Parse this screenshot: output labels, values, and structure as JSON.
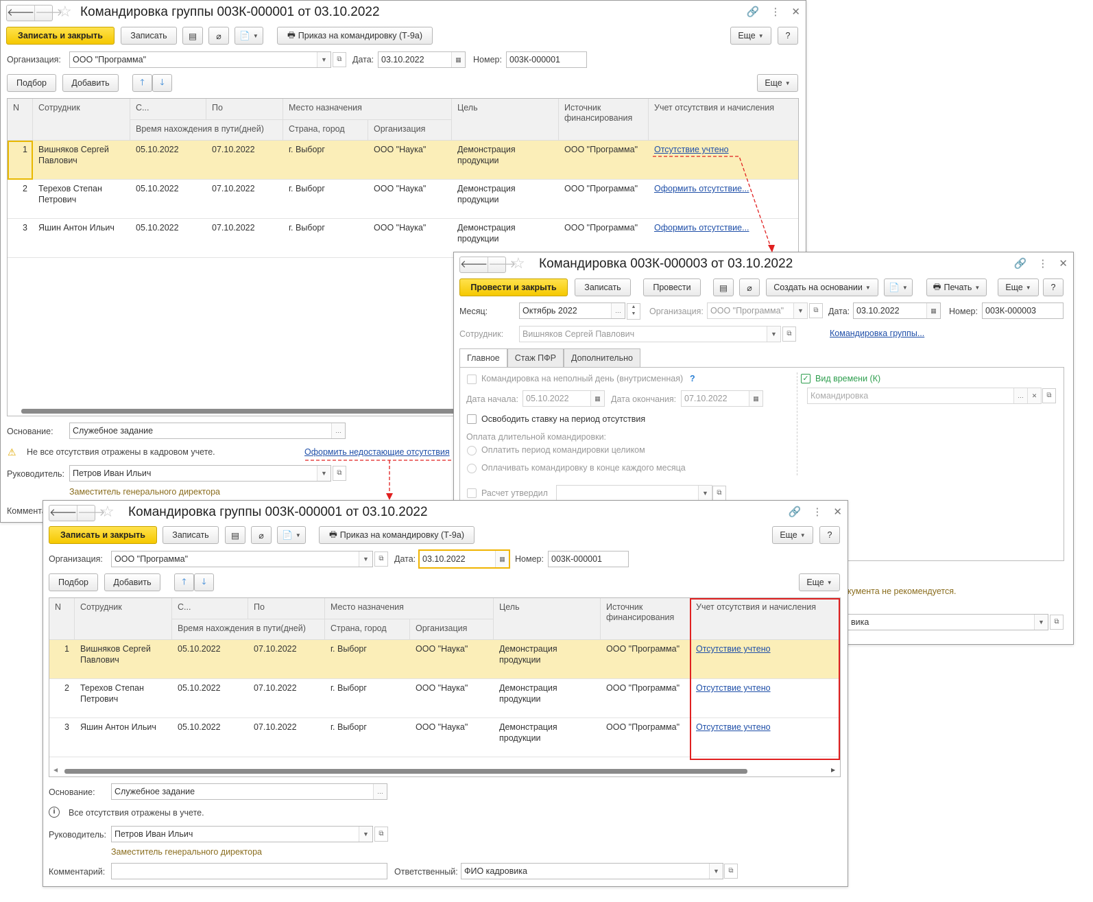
{
  "win1": {
    "title": "Командировка группы 003К-000001 от 03.10.2022",
    "save_close": "Записать и закрыть",
    "save": "Записать",
    "order_btn": "Приказ на командировку (Т-9а)",
    "more": "Еще",
    "help": "?",
    "org_label": "Организация:",
    "org_value": "ООО \"Программа\"",
    "date_label": "Дата:",
    "date_value": "03.10.2022",
    "num_label": "Номер:",
    "num_value": "003К-000001",
    "pick": "Подбор",
    "add": "Добавить",
    "columns": {
      "n": "N",
      "employee": "Сотрудник",
      "from": "С...",
      "to": "По",
      "travel": "Время нахождения в пути(дней)",
      "dest": "Место назначения",
      "city": "Страна, город",
      "org": "Организация",
      "goal": "Цель",
      "funding": "Источник финансирования",
      "accounting": "Учет отсутствия и начисления"
    },
    "rows": [
      {
        "n": "1",
        "employee": "Вишняков Сергей Павлович",
        "from": "05.10.2022",
        "to": "07.10.2022",
        "city": "г. Выборг",
        "org": "ООО \"Наука\"",
        "goal": "Демонстрация продукции",
        "funding": "ООО \"Программа\"",
        "accounting": "Отсутствие учтено"
      },
      {
        "n": "2",
        "employee": "Терехов Степан Петрович",
        "from": "05.10.2022",
        "to": "07.10.2022",
        "city": "г. Выборг",
        "org": "ООО \"Наука\"",
        "goal": "Демонстрация продукции",
        "funding": "ООО \"Программа\"",
        "accounting": "Оформить отсутствие..."
      },
      {
        "n": "3",
        "employee": "Яшин Антон Ильич",
        "from": "05.10.2022",
        "to": "07.10.2022",
        "city": "г. Выборг",
        "org": "ООО \"Наука\"",
        "goal": "Демонстрация продукции",
        "funding": "ООО \"Программа\"",
        "accounting": "Оформить отсутствие..."
      }
    ],
    "basis_label": "Основание:",
    "basis_value": "Служебное задание",
    "warning": "Не все отсутствия отражены в кадровом учете.",
    "warning_link": "Оформить недостающие отсутствия",
    "head_label": "Руководитель:",
    "head_value": "Петров Иван Ильич",
    "head_position": "Заместитель генерального директора",
    "comment_label": "Коммента"
  },
  "win2": {
    "title": "Командировка 003К-000003 от 03.10.2022",
    "post_close": "Провести и закрыть",
    "save": "Записать",
    "post": "Провести",
    "create_basis": "Создать на основании",
    "print": "Печать",
    "more": "Еще",
    "help": "?",
    "month_label": "Месяц:",
    "month_value": "Октябрь 2022",
    "org_label": "Организация:",
    "org_value": "ООО \"Программа\"",
    "date_label": "Дата:",
    "date_value": "03.10.2022",
    "num_label": "Номер:",
    "num_value": "003К-000003",
    "emp_label": "Сотрудник:",
    "emp_value": "Вишняков Сергей Павлович",
    "group_link": "Командировка группы...",
    "tabs": [
      "Главное",
      "Стаж ПФР",
      "Дополнительно"
    ],
    "partial_day": "Командировка на неполный день (внутрисменная)",
    "q": "?",
    "start_label": "Дата начала:",
    "start_value": "05.10.2022",
    "end_label": "Дата окончания:",
    "end_value": "07.10.2022",
    "free_rate": "Освободить ставку на период отсутствия",
    "long_pay": "Оплата длительной командировки:",
    "pay_whole": "Оплатить период командировки целиком",
    "pay_monthly": "Оплачивать командировку в конце каждого месяца",
    "calc_approved": "Расчет утвердил",
    "time_kind": "Вид времени (К)",
    "time_kind_placeholder": "Командировка",
    "footer_note": "кумента не рекомендуется.",
    "footer_field": "вика"
  },
  "win3": {
    "title": "Командировка группы 003К-000001 от 03.10.2022",
    "save_close": "Записать и закрыть",
    "save": "Записать",
    "order_btn": "Приказ на командировку (Т-9а)",
    "more": "Еще",
    "help": "?",
    "org_label": "Организация:",
    "org_value": "ООО \"Программа\"",
    "date_label": "Дата:",
    "date_value": "03.10.2022",
    "num_label": "Номер:",
    "num_value": "003К-000001",
    "pick": "Подбор",
    "add": "Добавить",
    "columns": {
      "n": "N",
      "employee": "Сотрудник",
      "from": "С...",
      "to": "По",
      "travel": "Время нахождения в пути(дней)",
      "dest": "Место назначения",
      "city": "Страна, город",
      "org": "Организация",
      "goal": "Цель",
      "funding": "Источник финансирования",
      "accounting": "Учет отсутствия и начисления"
    },
    "rows": [
      {
        "n": "1",
        "employee": "Вишняков Сергей Павлович",
        "from": "05.10.2022",
        "to": "07.10.2022",
        "city": "г. Выборг",
        "org": "ООО \"Наука\"",
        "goal": "Демонстрация продукции",
        "funding": "ООО \"Программа\"",
        "accounting": "Отсутствие учтено"
      },
      {
        "n": "2",
        "employee": "Терехов Степан Петрович",
        "from": "05.10.2022",
        "to": "07.10.2022",
        "city": "г. Выборг",
        "org": "ООО \"Наука\"",
        "goal": "Демонстрация продукции",
        "funding": "ООО \"Программа\"",
        "accounting": "Отсутствие учтено"
      },
      {
        "n": "3",
        "employee": "Яшин Антон Ильич",
        "from": "05.10.2022",
        "to": "07.10.2022",
        "city": "г. Выборг",
        "org": "ООО \"Наука\"",
        "goal": "Демонстрация продукции",
        "funding": "ООО \"Программа\"",
        "accounting": "Отсутствие учтено"
      }
    ],
    "basis_label": "Основание:",
    "basis_value": "Служебное задание",
    "info": "Все отсутствия отражены в учете.",
    "head_label": "Руководитель:",
    "head_value": "Петров Иван Ильич",
    "head_position": "Заместитель генерального директора",
    "comment_label": "Комментарий:",
    "comment_value": "",
    "resp_label": "Ответственный:",
    "resp_value": "ФИО кадровика"
  },
  "colors": {
    "accent": "#f5c800",
    "link": "#1f4fa8",
    "selected_row": "#fbeeb8",
    "highlight": "#e02020",
    "warning": "#f0c000"
  }
}
